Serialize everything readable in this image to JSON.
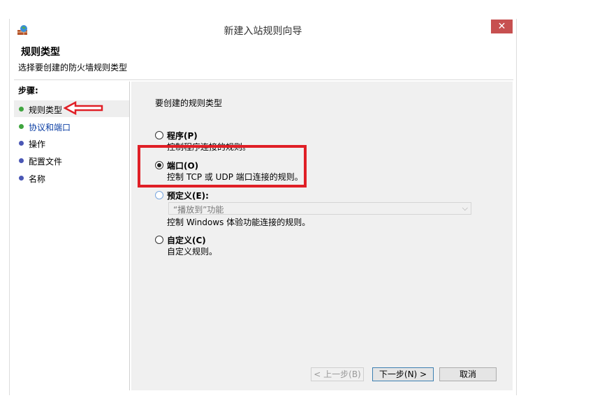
{
  "window": {
    "title": "新建入站规则向导",
    "close_glyph": "✕"
  },
  "header": {
    "title": "规则类型",
    "subtitle": "选择要创建的防火墙规则类型"
  },
  "steps": {
    "title": "步骤:",
    "items": [
      {
        "label": "规则类型"
      },
      {
        "label": "协议和端口"
      },
      {
        "label": "操作"
      },
      {
        "label": "配置文件"
      },
      {
        "label": "名称"
      }
    ]
  },
  "main": {
    "question": "要创建的规则类型",
    "options": [
      {
        "title": "程序(P)",
        "desc": "控制程序连接的规则。",
        "selected": false
      },
      {
        "title": "端口(O)",
        "desc": "控制 TCP 或 UDP 端口连接的规则。",
        "selected": true
      },
      {
        "title": "预定义(E):",
        "desc": "控制 Windows 体验功能连接的规则。",
        "selected": false
      },
      {
        "title": "自定义(C)",
        "desc": "自定义规则。",
        "selected": false
      }
    ],
    "predefined_dropdown": {
      "value": "“播放到”功能"
    }
  },
  "buttons": {
    "back": "< 上一步(B)",
    "next": "下一步(N) >",
    "cancel": "取消"
  },
  "colors": {
    "annotation": "#e01f26",
    "close_button": "#c75050",
    "link": "#0b3ea4"
  }
}
